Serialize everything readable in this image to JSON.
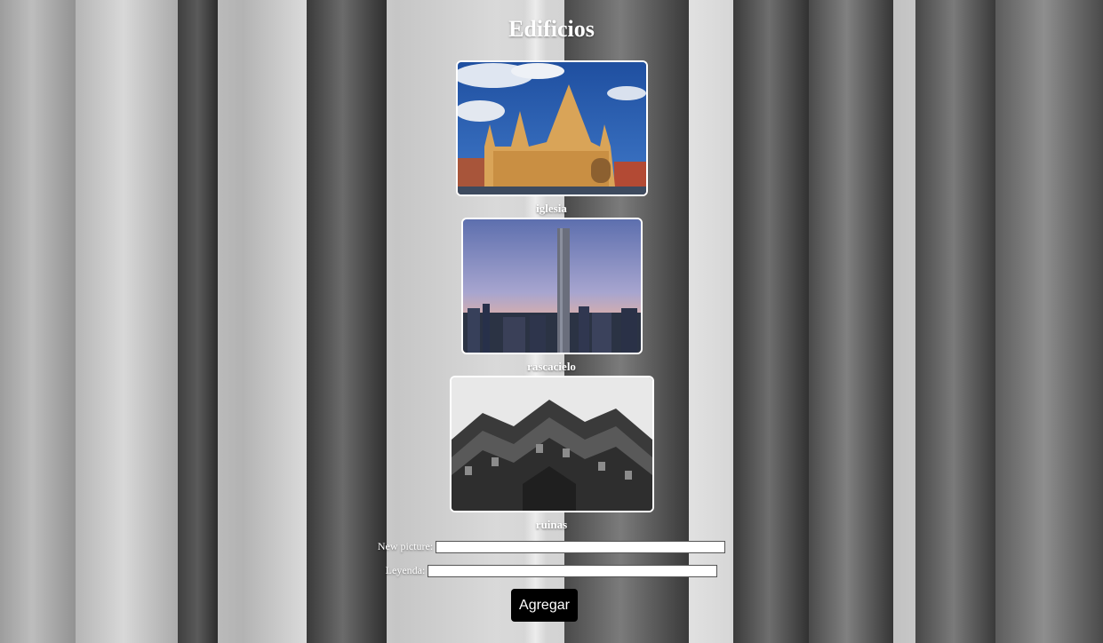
{
  "page": {
    "title": "Edificios"
  },
  "gallery": [
    {
      "caption": "iglesia"
    },
    {
      "caption": "rascacielo"
    },
    {
      "caption": "ruinas"
    }
  ],
  "form": {
    "picture_label": "New picture:",
    "picture_value": "",
    "caption_label": "Leyenda:",
    "caption_value": "",
    "submit_label": "Agregar"
  }
}
